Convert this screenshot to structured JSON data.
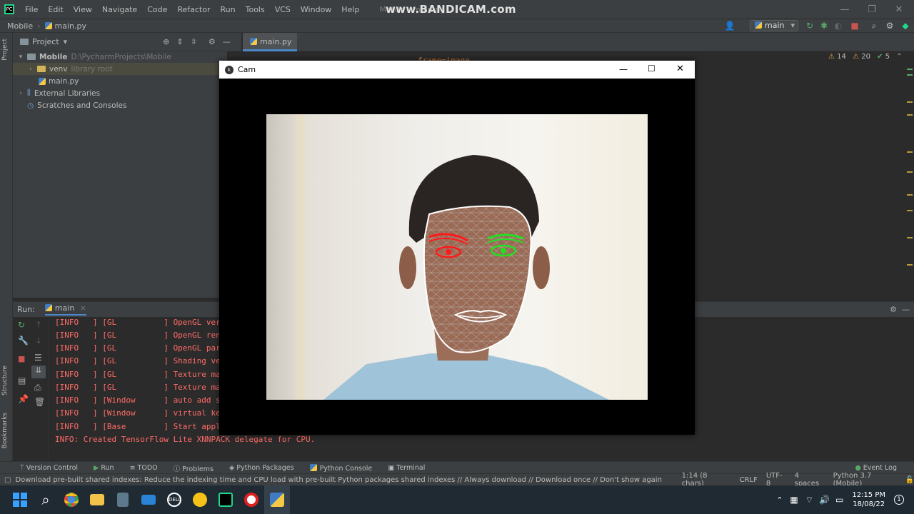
{
  "menubar": {
    "items": [
      "File",
      "Edit",
      "View",
      "Navigate",
      "Code",
      "Refactor",
      "Run",
      "Tools",
      "VCS",
      "Window",
      "Help"
    ],
    "window_title": "Mobile - main.py",
    "watermark": "www.BANDICAM.com"
  },
  "navbar": {
    "project": "Mobile",
    "file": "main.py"
  },
  "toolbar": {
    "run_config": "main"
  },
  "left_strip": {
    "project_label": "Project",
    "structure_label": "Structure",
    "bookmarks_label": "Bookmarks"
  },
  "project_panel": {
    "header": "Project",
    "root_name": "Mobile",
    "root_path": "D:\\PycharmProjects\\Mobile",
    "venv_name": "venv",
    "venv_note": "library root",
    "main_file": "main.py",
    "external_libraries": "External Libraries",
    "scratches": "Scratches and Consoles"
  },
  "editor": {
    "tab": "main.py",
    "warnings": "14",
    "weak_warnings": "20",
    "typos": "5",
    "code_fragment": "frame=image"
  },
  "run_panel": {
    "label": "Run:",
    "config": "main",
    "lines": [
      "[INFO   ] [GL          ] OpenGL ver",
      "[INFO   ] [GL          ] OpenGL ren",
      "[INFO   ] [GL          ] OpenGL par",
      "[INFO   ] [GL          ] Shading ve",
      "[INFO   ] [GL          ] Texture ma",
      "[INFO   ] [GL          ] Texture ma",
      "[INFO   ] [Window      ] auto add s",
      "[INFO   ] [Window      ] virtual ke",
      "[INFO   ] [Base        ] Start appl",
      "INFO: Created TensorFlow Lite XNNPACK delegate for CPU."
    ]
  },
  "bottom_tabs": [
    "Version Control",
    "Run",
    "TODO",
    "Problems",
    "Python Packages",
    "Python Console",
    "Terminal"
  ],
  "event_log": "Event Log",
  "status_bar": {
    "message": "Download pre-built shared indexes: Reduce the indexing time and CPU load with pre-built Python packages shared indexes // Always download // Download once // Don't show again // Configure... (2... (2 minute",
    "position": "1:14 (8 chars)",
    "line_sep": "CRLF",
    "encoding": "UTF-8",
    "indent": "4 spaces",
    "interpreter": "Python 3.7 (Mobile)"
  },
  "cam_window": {
    "title": "Cam"
  },
  "taskbar": {
    "time": "12:15 PM",
    "date": "18/08/22"
  },
  "colors": {
    "accent": "#4a88c7",
    "error_text": "#ff6b68",
    "left_eye": "#ff1a1a",
    "right_eye": "#22e022"
  }
}
